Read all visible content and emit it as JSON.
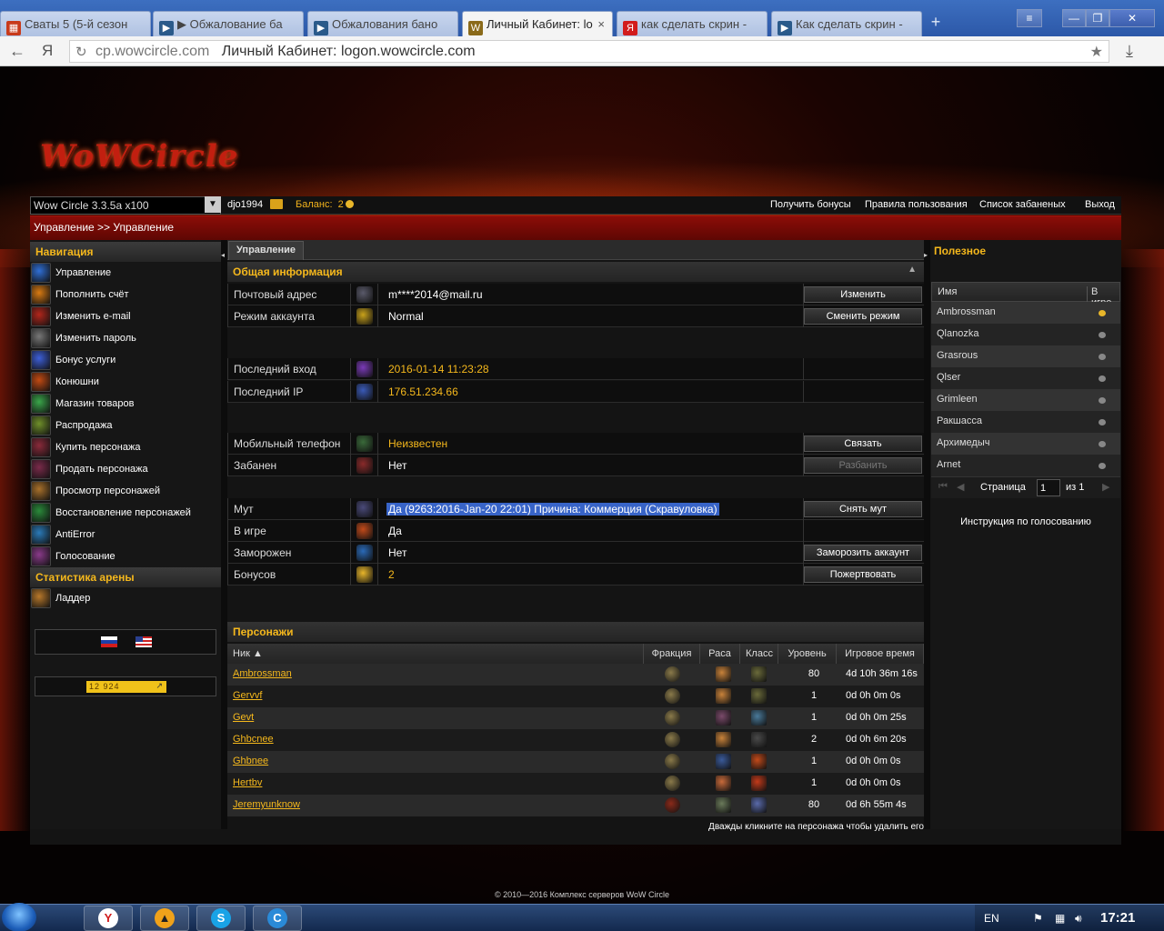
{
  "browser": {
    "tabs": [
      {
        "label": "Сваты 5 (5-й сезон",
        "icon": "film-icon"
      },
      {
        "label": "▶ Обжалование ба",
        "icon": "video-icon"
      },
      {
        "label": "Обжалования бано",
        "icon": "video-icon"
      },
      {
        "label": "Личный Кабинет: lo",
        "icon": "wowcircle-icon",
        "active": true
      },
      {
        "label": "как сделать скрин -",
        "icon": "yandex-icon"
      },
      {
        "label": "Как сделать скрин -",
        "icon": "video-icon"
      }
    ],
    "url_domain": "cp.wowcircle.com",
    "url_title": "Личный Кабинет: logon.wowcircle.com",
    "nav_ya": "Я"
  },
  "logo_text": "WoWCircle",
  "topbar": {
    "realm": "Wow Circle 3.3.5a x100",
    "username": "djo1994",
    "balance_label": "Баланс:",
    "balance_value": "2",
    "links": [
      "Получить бонусы",
      "Правила пользования",
      "Список забаненых",
      "Выход"
    ]
  },
  "breadcrumb": "Управление >> Управление",
  "nav": {
    "title": "Навигация",
    "items": [
      {
        "label": "Управление",
        "color": "#2f6fd6"
      },
      {
        "label": "Пополнить счёт",
        "color": "#d87a12"
      },
      {
        "label": "Изменить e-mail",
        "color": "#b2261b"
      },
      {
        "label": "Изменить пароль",
        "color": "#777777"
      },
      {
        "label": "Бонус услуги",
        "color": "#3d5fd8"
      },
      {
        "label": "Конюшни",
        "color": "#c24a12"
      },
      {
        "label": "Магазин товаров",
        "color": "#3aa64a"
      },
      {
        "label": "Распродажа",
        "color": "#6f8f2a"
      },
      {
        "label": "Купить персонажа",
        "color": "#8a2a3a"
      },
      {
        "label": "Продать персонажа",
        "color": "#7a2a4a"
      },
      {
        "label": "Просмотр персонажей",
        "color": "#a8702a"
      },
      {
        "label": "Восстановление персонажей",
        "color": "#2a8a3a"
      },
      {
        "label": "AntiError",
        "color": "#2a7ab8"
      },
      {
        "label": "Голосование",
        "color": "#8a3a8a"
      }
    ],
    "arena_title": "Статистика арены",
    "arena_items": [
      {
        "label": "Ладдер",
        "color": "#b8782a"
      }
    ],
    "counter_value": "12 924"
  },
  "center": {
    "tab": "Управление",
    "section_title": "Общая информация",
    "rows": [
      {
        "label": "Почтовый адрес",
        "value": "m****2014@mail.ru",
        "gold": false,
        "button": "Изменить",
        "icon_color": "#5a5a6a"
      },
      {
        "label": "Режим аккаунта",
        "value": "Normal",
        "gold": false,
        "button": "Сменить режим",
        "icon_color": "#c9a21a"
      },
      {
        "label": "Последний вход",
        "value": "2016-01-14 11:23:28",
        "gold": true,
        "button": "",
        "icon_color": "#7a3ab8"
      },
      {
        "label": "Последний IP",
        "value": "176.51.234.66",
        "gold": true,
        "button": "",
        "icon_color": "#3a5ab8"
      },
      {
        "label": "Мобильный телефон",
        "value": "Неизвестен",
        "gold": true,
        "button": "Связать",
        "icon_color": "#3a6a3a"
      },
      {
        "label": "Забанен",
        "value": "Нет",
        "gold": false,
        "button": "Разбанить",
        "disabled": true,
        "icon_color": "#8a2a2a"
      },
      {
        "label": "Мут",
        "value": "Да (9263:2016-Jan-20 22:01) Причина: Коммерция (Скравуловка)",
        "selected": true,
        "button": "Снять мут",
        "icon_color": "#4a4a7a"
      },
      {
        "label": "В игре",
        "value": "Да",
        "gold": false,
        "button": "",
        "icon_color": "#c24a1a"
      },
      {
        "label": "Заморожен",
        "value": "Нет",
        "gold": false,
        "button": "Заморозить аккаунт",
        "icon_color": "#2a6ab8"
      },
      {
        "label": "Бонусов",
        "value": "2",
        "gold": true,
        "button": "Пожертвовать",
        "icon_color": "#e8b62a"
      }
    ],
    "characters_title": "Персонажи",
    "char_columns": [
      "Ник ▲",
      "Фракция",
      "Раса",
      "Класс",
      "Уровень",
      "Игровое время"
    ],
    "characters": [
      {
        "nick": "Ambrossman",
        "level": "80",
        "time": "4d 10h 36m 16s",
        "race": "#c8823a",
        "cls": "#6a6a3a",
        "faction": "#8a7a4a"
      },
      {
        "nick": "Gervvf",
        "level": "1",
        "time": "0d 0h 0m 0s",
        "race": "#c8823a",
        "cls": "#6a6a3a",
        "faction": "#8a7a4a"
      },
      {
        "nick": "Gevt",
        "level": "1",
        "time": "0d 0h 0m 25s",
        "race": "#7a4a6a",
        "cls": "#4a7a9a",
        "faction": "#8a7a4a"
      },
      {
        "nick": "Ghbcnee",
        "level": "2",
        "time": "0d 0h 6m 20s",
        "race": "#c8823a",
        "cls": "#4a4a4a",
        "faction": "#8a7a4a"
      },
      {
        "nick": "Ghbnee",
        "level": "1",
        "time": "0d 0h 0m 0s",
        "race": "#3a5a9a",
        "cls": "#c24a1a",
        "faction": "#8a7a4a"
      },
      {
        "nick": "Hertbv",
        "level": "1",
        "time": "0d 0h 0m 0s",
        "race": "#c86a3a",
        "cls": "#c23a1a",
        "faction": "#8a7a4a"
      },
      {
        "nick": "Jeremyunknow",
        "level": "80",
        "time": "0d 6h 55m 4s",
        "race": "#6a7a5a",
        "cls": "#5a6aaa",
        "faction": "#8a2a1a"
      }
    ],
    "char_hint": "Дважды кликните на персонажа чтобы удалить его"
  },
  "right": {
    "title": "Полезное",
    "col_name": "Имя",
    "col_ingame": "В игре",
    "users": [
      {
        "name": "Ambrossman",
        "online": true
      },
      {
        "name": "Qlanozka",
        "online": false
      },
      {
        "name": "Grasrous",
        "online": false
      },
      {
        "name": "Qlser",
        "online": false
      },
      {
        "name": "Grimleen",
        "online": false
      },
      {
        "name": "Ракшасса",
        "online": false
      },
      {
        "name": "Архимедыч",
        "online": false
      },
      {
        "name": "Arnet",
        "online": false
      }
    ],
    "page_label": "Страница",
    "page_value": "1",
    "page_of": "из 1",
    "vote_link": "Инструкция по голосованию"
  },
  "footer": "© 2010—2016 Комплекс серверов WoW Circle",
  "taskbar": {
    "lang": "EN",
    "clock": "17:21"
  }
}
